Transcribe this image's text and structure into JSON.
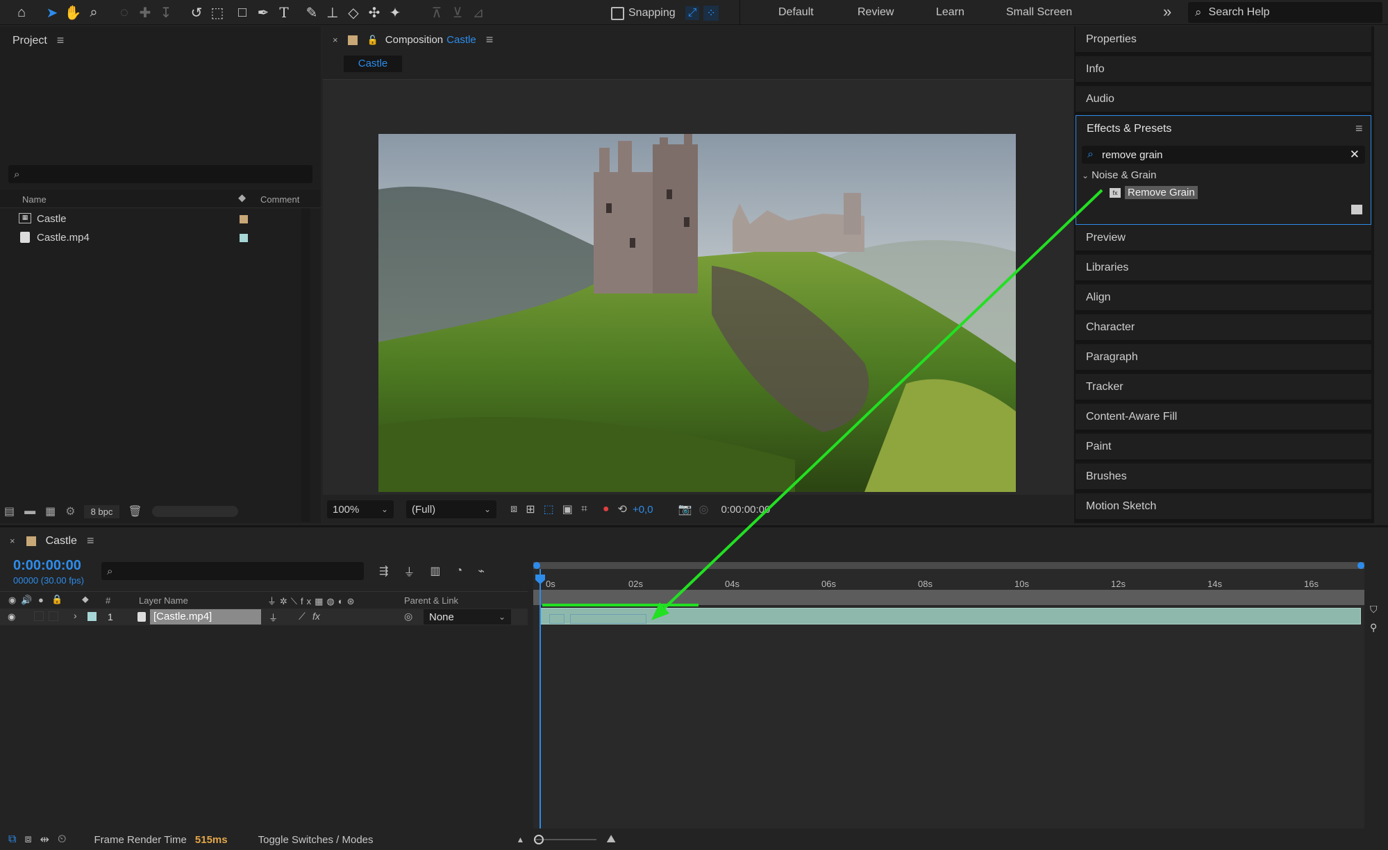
{
  "toolbar": {
    "snapping_label": "Snapping",
    "workspaces": [
      "Default",
      "Review",
      "Learn",
      "Small Screen"
    ],
    "search_placeholder": "Search Help",
    "more_glyph": "»"
  },
  "project": {
    "title": "Project",
    "search_placeholder": "",
    "col_name": "Name",
    "col_comment": "Comment",
    "items": [
      {
        "name": "Castle",
        "type": "composition",
        "color": "#c9a877"
      },
      {
        "name": "Castle.mp4",
        "type": "footage",
        "color": "#a6d6d6"
      }
    ],
    "bpc_label": "8 bpc"
  },
  "composition": {
    "tab_prefix": "Composition",
    "tab_name": "Castle",
    "subtab": "Castle",
    "zoom_value": "100%",
    "resolution_value": "(Full)",
    "exposure_value": "+0,0",
    "timecode": "0:00:00:00"
  },
  "right_panels": {
    "top": [
      "Properties",
      "Info",
      "Audio"
    ],
    "effects": {
      "title": "Effects & Presets",
      "search_value": "remove grain",
      "category": "Noise & Grain",
      "effect": "Remove Grain"
    },
    "bottom": [
      "Preview",
      "Libraries",
      "Align",
      "Character",
      "Paragraph",
      "Tracker",
      "Content-Aware Fill",
      "Paint",
      "Brushes",
      "Motion Sketch"
    ]
  },
  "timeline": {
    "tab_name": "Castle",
    "timecode": "0:00:00:00",
    "fps_info": "00000 (30.00 fps)",
    "col_number": "#",
    "col_layer_name": "Layer Name",
    "col_parent": "Parent & Link",
    "layer": {
      "number": "1",
      "name": "[Castle.mp4]",
      "parent": "None",
      "color": "#a6d6d6"
    },
    "ruler_labels": [
      "0s",
      "02s",
      "04s",
      "06s",
      "08s",
      "10s",
      "12s",
      "14s",
      "16s"
    ]
  },
  "statusbar": {
    "render_label": "Frame Render Time",
    "render_value": "515ms",
    "toggle_label": "Toggle Switches / Modes"
  },
  "colors": {
    "accent": "#2d8ceb",
    "annotation_arrow": "#22e022",
    "render_value": "#e3a74a",
    "layer_bar": "#8fb8ad"
  },
  "icons": [
    "home-icon",
    "selection-tool-icon",
    "hand-tool-icon",
    "zoom-tool-icon",
    "rotate-tool-icon",
    "rectangle-tool-icon",
    "pen-tool-icon",
    "type-tool-icon",
    "brush-tool-icon",
    "stamp-tool-icon",
    "eraser-tool-icon",
    "roto-brush-icon",
    "puppet-pin-icon",
    "search-icon",
    "menu-icon",
    "close-icon",
    "lock-icon",
    "camera-icon",
    "eye-icon",
    "trash-icon",
    "folder-icon"
  ]
}
